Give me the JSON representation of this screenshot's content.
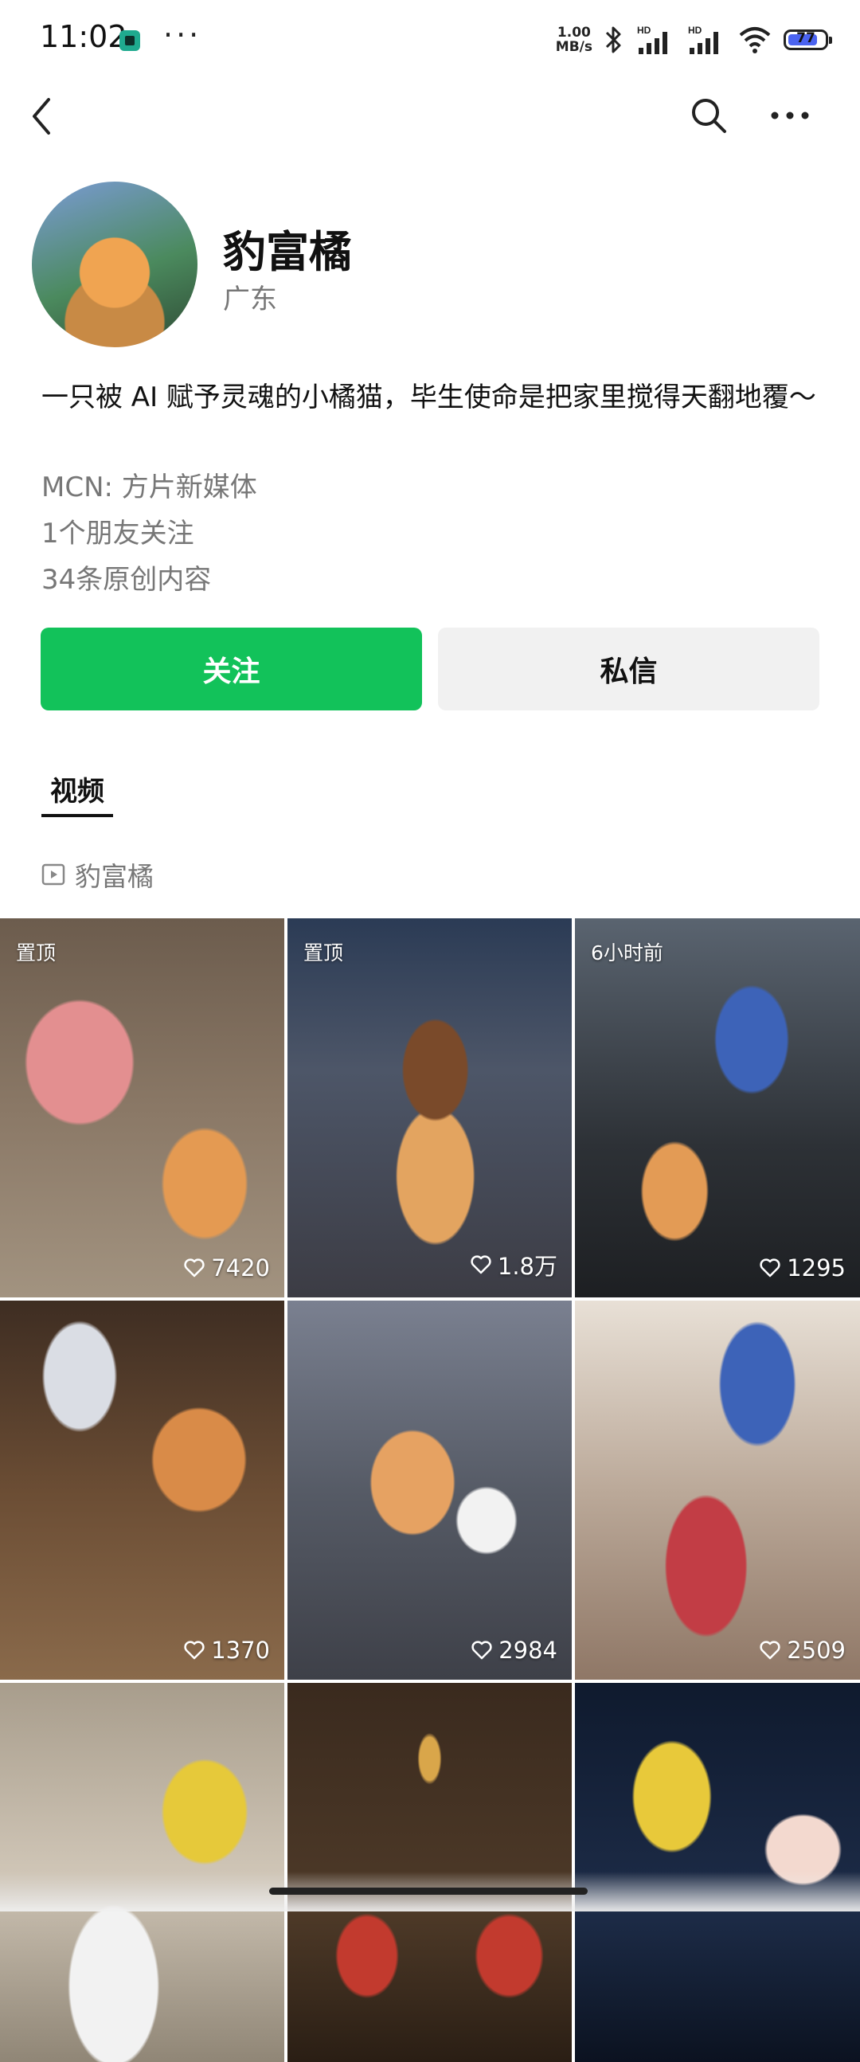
{
  "status_bar": {
    "time": "11:02",
    "dots": "···",
    "speed_value": "1.00",
    "speed_unit": "MB/s",
    "battery_level": "77",
    "icons": [
      "bluetooth-icon",
      "hd-signal-icon",
      "hd-signal-icon",
      "wifi-icon",
      "battery-icon"
    ]
  },
  "nav": {
    "icons": [
      "back-chevron-icon",
      "search-icon",
      "more-icon"
    ]
  },
  "profile": {
    "name": "豹富橘",
    "region": "广东",
    "bio": "一只被 AI 赋予灵魂的小橘猫，毕生使命是把家里搅得天翻地覆～",
    "mcn": "MCN: 方片新媒体",
    "friends": "1个朋友关注",
    "originals": "34条原创内容"
  },
  "actions": {
    "follow": "关注",
    "message": "私信",
    "follow_color": "#12c25a"
  },
  "tabs": [
    {
      "label": "视频",
      "active": true
    }
  ],
  "channel": {
    "label": "豹富橘",
    "icon": "video-channel-icon"
  },
  "videos": [
    {
      "badge": "置顶",
      "likes": "7420"
    },
    {
      "badge": "置顶",
      "likes": "1.8万"
    },
    {
      "badge": "6小时前",
      "likes": "1295"
    },
    {
      "badge": "",
      "likes": "1370"
    },
    {
      "badge": "",
      "likes": "2984"
    },
    {
      "badge": "",
      "likes": "2509"
    },
    {
      "badge": "",
      "likes": ""
    },
    {
      "badge": "",
      "likes": ""
    },
    {
      "badge": "",
      "likes": ""
    }
  ]
}
